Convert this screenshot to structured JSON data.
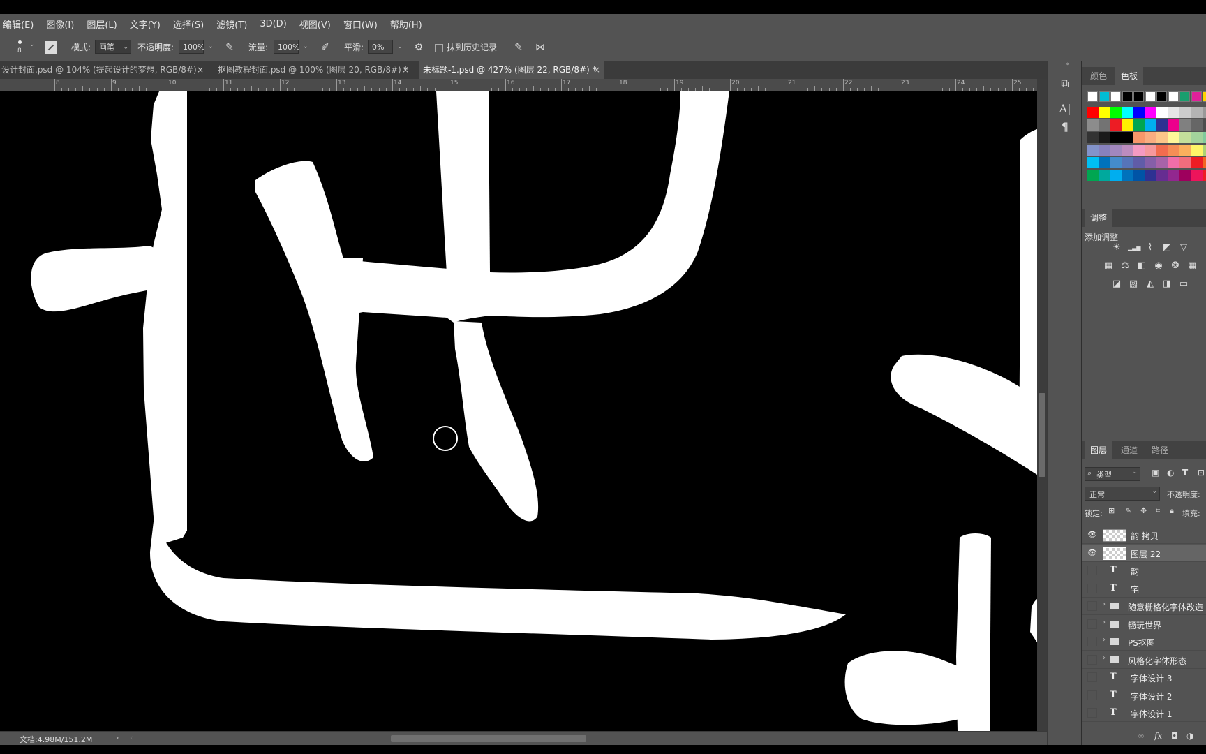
{
  "menu": [
    "编辑(E)",
    "图像(I)",
    "图层(L)",
    "文字(Y)",
    "选择(S)",
    "滤镜(T)",
    "3D(D)",
    "视图(V)",
    "窗口(W)",
    "帮助(H)"
  ],
  "options": {
    "brush_size": "8",
    "mode_label": "模式:",
    "mode_value": "画笔",
    "opacity_label": "不透明度:",
    "opacity_value": "100%",
    "flow_label": "流量:",
    "flow_value": "100%",
    "smoothing_label": "平滑:",
    "smoothing_value": "0%",
    "history_label": "抹到历史记录"
  },
  "tabs": [
    {
      "label": "设计封面.psd @ 104% (提起设计的梦想, RGB/8#)"
    },
    {
      "label": "抠图教程封面.psd @ 100% (图层 20, RGB/8#) *"
    },
    {
      "label": "未标题-1.psd @ 427% (图层 22, RGB/8#) *"
    }
  ],
  "ruler_numbers": [
    "8",
    "9",
    "10",
    "11",
    "12",
    "13",
    "14",
    "15",
    "16",
    "17",
    "18",
    "19",
    "20",
    "21",
    "22",
    "23",
    "24",
    "25"
  ],
  "status": {
    "doc_info": "文档:4.98M/151.2M"
  },
  "color_panel": {
    "tabs": [
      "颜色",
      "色板"
    ],
    "active_tab": 1,
    "swatch_rows": [
      [
        "#ffffff",
        "#00bcd4",
        "#ffffff",
        "#000000",
        "#000000",
        "#ffffff",
        "#000000",
        "#ffffff",
        "#1a9e6e",
        "#e0219a",
        "#ffd400"
      ],
      [
        "#ff0000",
        "#ffff00",
        "#00ff00",
        "#00ffff",
        "#0000ff",
        "#ff00ff",
        "#ffffff",
        "#e6e6e6",
        "#cccccc",
        "#b3b3b3",
        "#999999"
      ],
      [
        "#8c8c8c",
        "#737373",
        "#ed1c24",
        "#fff200",
        "#00a651",
        "#00aeef",
        "#2e3192",
        "#ec008c",
        "#808080",
        "#666666",
        "#4d4d4d"
      ],
      [
        "#333333",
        "#1a1a1a",
        "#000000",
        "#000000",
        "#f7976a",
        "#f9ad81",
        "#fdc689",
        "#fff799",
        "#c4df9b",
        "#a3d39c",
        "#82ca9c"
      ],
      [
        "#8393ca",
        "#8781bd",
        "#a187be",
        "#bc8cbf",
        "#f49ac2",
        "#f6989d",
        "#f26c4f",
        "#f68e56",
        "#fbaf5d",
        "#fff568",
        "#acd373"
      ],
      [
        "#00bff3",
        "#0072bc",
        "#448ccb",
        "#5674b9",
        "#605ca8",
        "#855fa8",
        "#a763a8",
        "#f06ea9",
        "#f26d7d",
        "#ed1c24",
        "#f26522"
      ],
      [
        "#00a651",
        "#00a99d",
        "#00aeef",
        "#0072bc",
        "#0054a6",
        "#2e3192",
        "#662d91",
        "#92278f",
        "#9e005d",
        "#ed145b",
        "#ed1c24"
      ]
    ]
  },
  "adjust_panel": {
    "title": "调整",
    "subtitle": "添加调整",
    "icons_row1": [
      "brightness-icon",
      "levels-icon",
      "curves-icon",
      "exposure-icon",
      "vibrance-icon"
    ],
    "icons_row2": [
      "hue-saturation-icon",
      "color-balance-icon",
      "black-white-icon",
      "photo-filter-icon",
      "channel-mixer-icon",
      "color-lookup-icon"
    ],
    "icons_row3": [
      "invert-icon",
      "posterize-icon",
      "threshold-icon",
      "selective-color-icon",
      "gradient-map-icon"
    ]
  },
  "layers_panel": {
    "tabs": [
      "图层",
      "通道",
      "路径"
    ],
    "filter_label": "类型",
    "blend_mode": "正常",
    "opacity_label": "不透明度:",
    "lock_label": "锁定:",
    "fill_label": "填充:",
    "layers": [
      {
        "name": "韵 拷贝",
        "kind": "pixel",
        "visible": true,
        "selected": false
      },
      {
        "name": "图层 22",
        "kind": "pixel",
        "visible": true,
        "selected": true
      },
      {
        "name": "韵",
        "kind": "text",
        "visible": false,
        "selected": false
      },
      {
        "name": "宅",
        "kind": "text",
        "visible": false,
        "selected": false
      },
      {
        "name": "随意栅格化字体改造",
        "kind": "folder",
        "visible": false,
        "selected": false
      },
      {
        "name": "畅玩世界",
        "kind": "folder",
        "visible": false,
        "selected": false
      },
      {
        "name": "PS抠图",
        "kind": "folder",
        "visible": false,
        "selected": false
      },
      {
        "name": "风格化字体形态",
        "kind": "folder",
        "visible": false,
        "selected": false
      },
      {
        "name": "字体设计 3",
        "kind": "text",
        "visible": false,
        "selected": false
      },
      {
        "name": "字体设计 2",
        "kind": "text",
        "visible": false,
        "selected": false
      },
      {
        "name": "字体设计 1",
        "kind": "text",
        "visible": false,
        "selected": false
      }
    ],
    "footer_icons": [
      "link-icon",
      "fx-icon",
      "mask-icon",
      "adjustment-icon"
    ]
  }
}
